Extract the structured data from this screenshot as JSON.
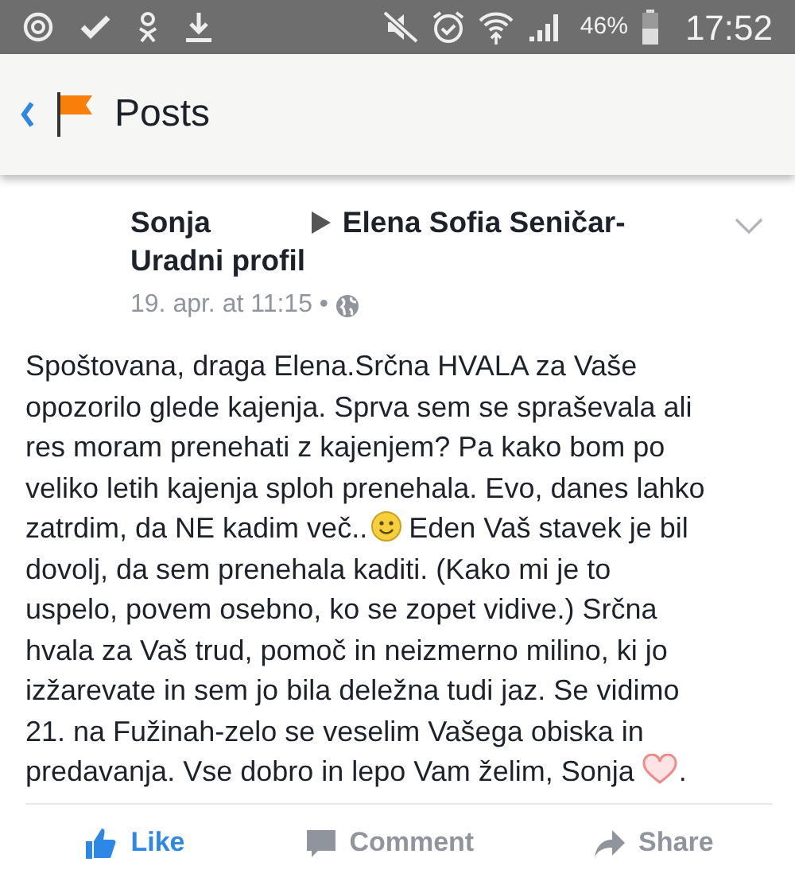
{
  "status_bar": {
    "battery": "46%",
    "time": "17:52"
  },
  "header": {
    "title": "Posts"
  },
  "post": {
    "author": "Sonja",
    "target": [
      "Elena Sofia Seničar-",
      "Uradni profil"
    ],
    "time": "19. apr. at 11:15 •",
    "body": [
      [
        "Spoštovana, draga Elena.Srčna HVALA za Vaše"
      ],
      [
        "opozorilo glede kajenja. Sprva sem se spraševala ali"
      ],
      [
        "res moram prenehati z kajenjem? Pa kako bom po"
      ],
      [
        "veliko letih kajenja sploh prenehala. Evo, danes lahko"
      ],
      [
        "zatrdim, da NE kadim več..",
        "Eden Vaš stavek je bil"
      ],
      [
        "dovolj, da sem prenehala kaditi. (Kako mi je to"
      ],
      [
        "uspelo, povem osebno, ko se zopet vidive.) Srčna"
      ],
      [
        "hvala za Vaš trud, pomoč in neizmerno milino, ki jo"
      ],
      [
        "izžarevate in sem jo bila deležna tudi jaz. Se vidimo"
      ],
      [
        "21. na Fužinah-zelo se veselim Vašega obiska in"
      ],
      [
        "predavanja. Vse dobro in lepo Vam želim, Sonja",
        "."
      ]
    ]
  },
  "actions": [
    {
      "kind": "like",
      "label": "Like",
      "selected": true
    },
    {
      "kind": "comment",
      "label": "Comment",
      "selected": false
    },
    {
      "kind": "share",
      "label": "Share",
      "selected": false
    }
  ]
}
